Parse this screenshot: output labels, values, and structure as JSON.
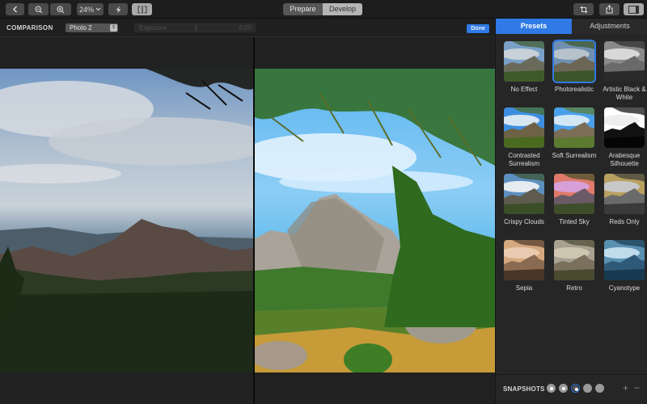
{
  "toolbar": {
    "zoom_level": "24%",
    "buttons": {
      "back": "back",
      "zoom_out": "zoom-out",
      "zoom_in": "zoom-in",
      "auto_enhance": "auto-enhance",
      "compare": "compare",
      "crop": "crop",
      "share": "share",
      "sidebar": "toggle-sidebar"
    },
    "mode_tabs": [
      {
        "label": "Prepare",
        "active": false
      },
      {
        "label": "Develop",
        "active": true
      }
    ]
  },
  "comparison_bar": {
    "label": "COMPARISON",
    "photo_select": "Photo 2",
    "adjustment_name": "Exposure",
    "adjustment_value": "0,00",
    "done_label": "Done"
  },
  "panel": {
    "tabs": [
      {
        "label": "Presets",
        "active": true
      },
      {
        "label": "Adjustments",
        "active": false
      }
    ],
    "presets": [
      {
        "label": "No Effect",
        "selected": false,
        "filter": "none"
      },
      {
        "label": "Photorealistic",
        "selected": true,
        "filter": "photo"
      },
      {
        "label": "Artistic Black & White",
        "selected": false,
        "filter": "bw"
      },
      {
        "label": "Contrasted Surrealism",
        "selected": false,
        "filter": "contrast"
      },
      {
        "label": "Soft Surrealism",
        "selected": false,
        "filter": "soft"
      },
      {
        "label": "Arabesque Silhouette",
        "selected": false,
        "filter": "silhouette"
      },
      {
        "label": "Crispy Clouds",
        "selected": false,
        "filter": "crispy"
      },
      {
        "label": "Tinted Sky",
        "selected": false,
        "filter": "tinted"
      },
      {
        "label": "Reds Only",
        "selected": false,
        "filter": "reds"
      },
      {
        "label": "Sepia",
        "selected": false,
        "filter": "sepia"
      },
      {
        "label": "Retro",
        "selected": false,
        "filter": "retro"
      },
      {
        "label": "Cyanotype",
        "selected": false,
        "filter": "cyano"
      }
    ],
    "snapshots": {
      "label": "SNAPSHOTS",
      "items": [
        {
          "state": "filled"
        },
        {
          "state": "filled"
        },
        {
          "state": "current"
        },
        {
          "state": "empty"
        },
        {
          "state": "empty"
        }
      ],
      "add_label": "+",
      "remove_label": "−"
    }
  },
  "colors": {
    "accent": "#2f7ae5",
    "background": "#202020",
    "panel": "#262626"
  }
}
